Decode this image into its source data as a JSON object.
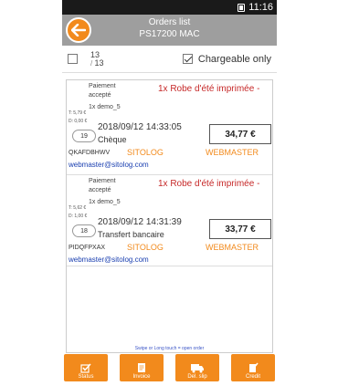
{
  "status_bar": {
    "time": "11:16"
  },
  "header": {
    "title": "Orders list",
    "subtitle": "PS17200 MAC"
  },
  "filter": {
    "count_top": "13",
    "count_bottom": "13",
    "chargeable_label": "Chargeable only"
  },
  "orders": [
    {
      "payment": "Paiement accepté",
      "title": "1x Robe d'été imprimée -",
      "qty": "1x demo_5",
      "t_label": "T: 5,79 €",
      "d_label": "D: 0,00 €",
      "badge": "19",
      "date": "2018/09/12 14:33:05",
      "payment_method": "Chèque",
      "amount": "34,77 €",
      "reference": "QKAFDBHWV",
      "site": "SITOLOG",
      "who": "WEBMASTER",
      "email": "webmaster@sitolog.com"
    },
    {
      "payment": "Paiement accepté",
      "title": "1x Robe d'été imprimée -",
      "qty": "1x demo_5",
      "t_label": "T: 5,62 €",
      "d_label": "D: 1,00 €",
      "badge": "18",
      "date": "2018/09/12 14:31:39",
      "payment_method": "Transfert bancaire",
      "amount": "33,77 €",
      "reference": "PIDQFPXAX",
      "site": "SITOLOG",
      "who": "WEBMASTER",
      "email": "webmaster@sitolog.com"
    }
  ],
  "hint": "Swipe or Long touch = open order",
  "toolbar": {
    "status": "Status",
    "invoice": "Invoice",
    "delivery": "Del. slip",
    "credit": "Credit"
  },
  "colors": {
    "accent": "#f28a1c",
    "header": "#9e9e9e",
    "title_red": "#c62828",
    "link_blue": "#1a3fb0"
  }
}
